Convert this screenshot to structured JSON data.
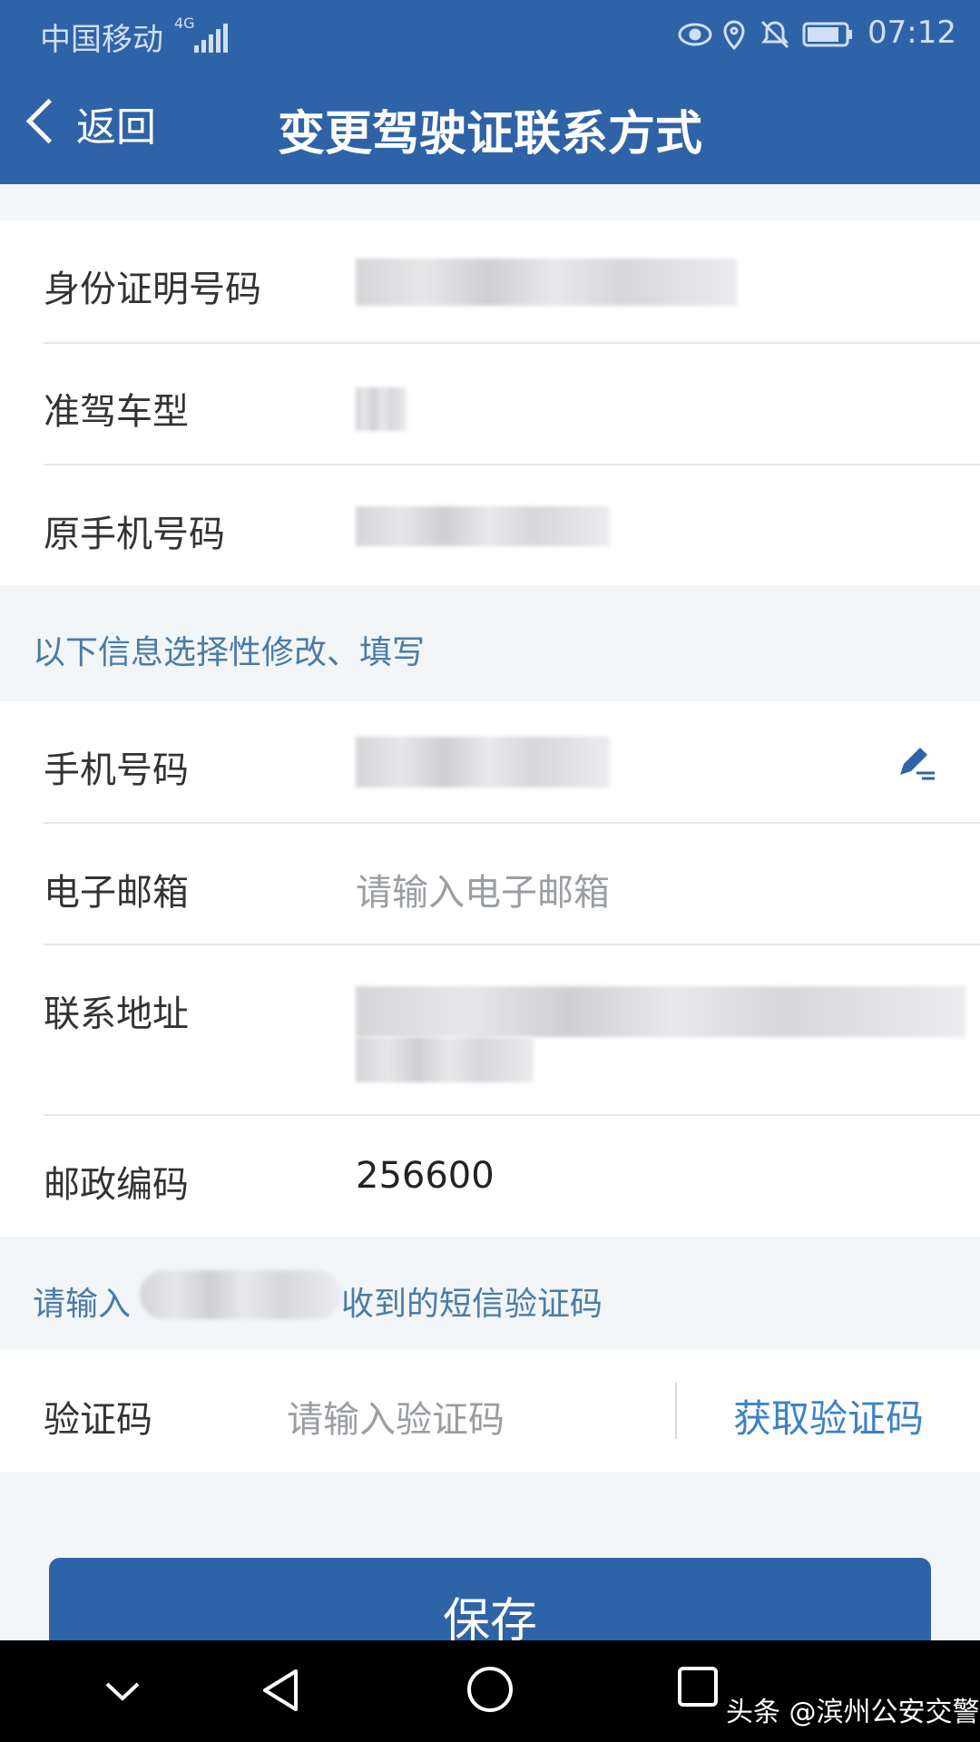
{
  "status_bar": {
    "carrier": "中国移动",
    "network": "4G",
    "time": "07:12"
  },
  "header": {
    "back_label": "返回",
    "title": "变更驾驶证联系方式"
  },
  "basic_info": {
    "id_number_label": "身份证明号码",
    "vehicle_class_label": "准驾车型",
    "old_phone_label": "原手机号码"
  },
  "optional_hint": "以下信息选择性修改、填写",
  "contact": {
    "phone_label": "手机号码",
    "email_label": "电子邮箱",
    "email_placeholder": "请输入电子邮箱",
    "address_label": "联系地址",
    "postcode_label": "邮政编码",
    "postcode_value": "256600"
  },
  "sms_hint": {
    "prefix": "请输入",
    "suffix": "收到的短信验证码"
  },
  "verification": {
    "label": "验证码",
    "placeholder": "请输入验证码",
    "get_code": "获取验证码"
  },
  "save_button": "保存",
  "watermark": "头条 @滨州公安交警",
  "icons": {
    "status": [
      "eye-icon",
      "location-icon",
      "bell-off-icon",
      "battery-icon"
    ],
    "edit": "edit-pen-icon",
    "nav": [
      "chevron-down-icon",
      "back-triangle-icon",
      "home-circle-icon",
      "recents-square-icon"
    ]
  },
  "colors": {
    "primary": "#2f63a8",
    "link": "#3c82c8",
    "hint": "#4a7ba8"
  }
}
